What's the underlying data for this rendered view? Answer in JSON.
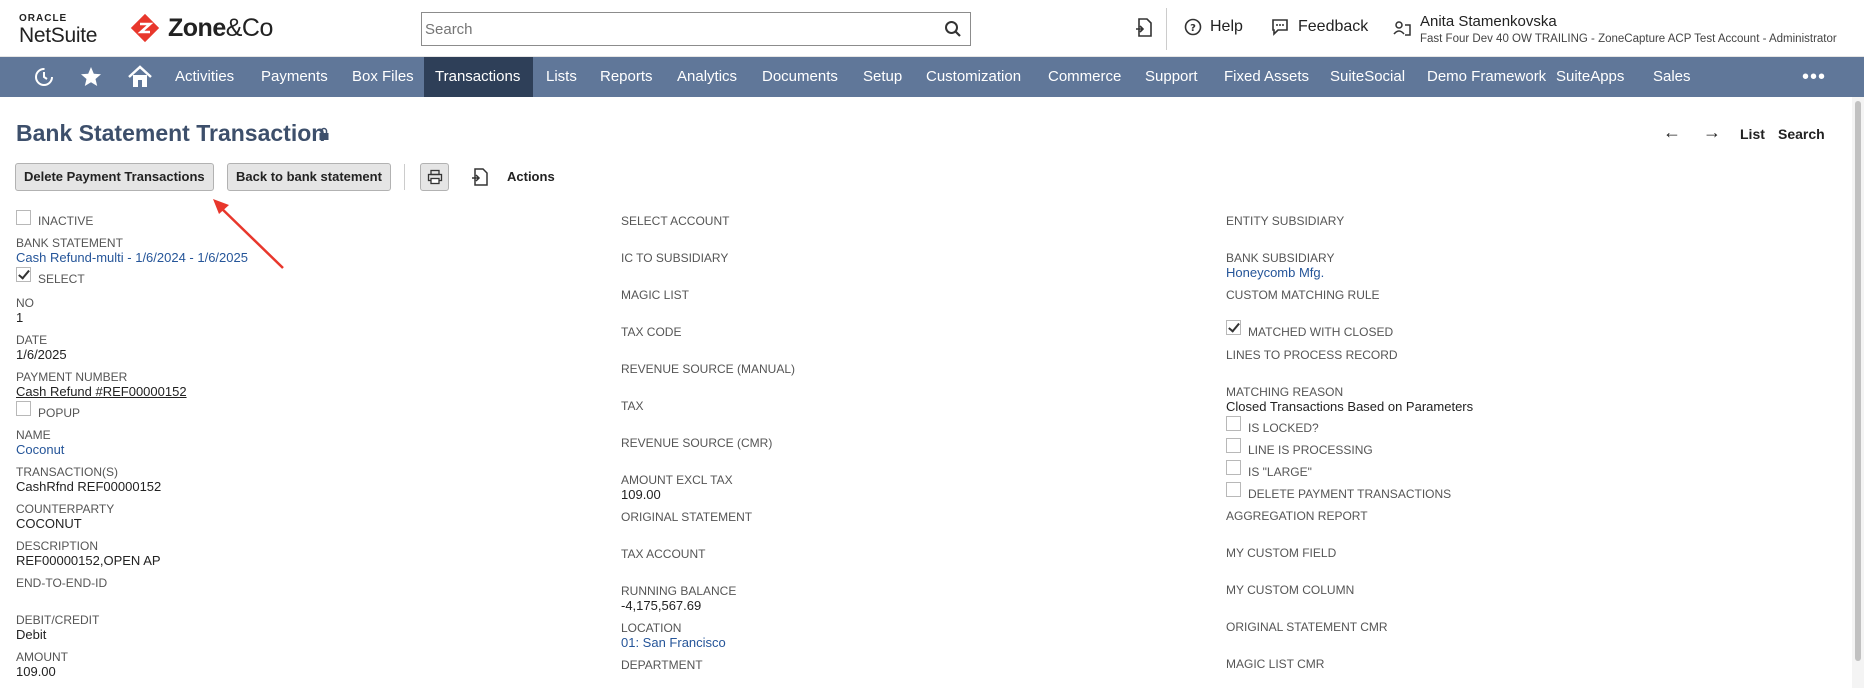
{
  "header": {
    "oracle": "ORACLE",
    "netsuite": "NetSuite",
    "zone": "Zone",
    "zone_co": "&Co",
    "search_placeholder": "Search",
    "help": "Help",
    "feedback": "Feedback",
    "user_name": "Anita Stamenkovska",
    "user_account": "Fast Four Dev 40 OW TRAILING - ZoneCapture ACP Test Account - Administrator"
  },
  "nav": {
    "items": [
      "Activities",
      "Payments",
      "Box Files",
      "Transactions",
      "Lists",
      "Reports",
      "Analytics",
      "Documents",
      "Setup",
      "Customization",
      "Commerce",
      "Support",
      "Fixed Assets",
      "SuiteSocial",
      "Demo Framework",
      "SuiteApps",
      "Sales"
    ],
    "active": "Transactions",
    "more": "•••"
  },
  "page": {
    "title": "Bank Statement Transaction",
    "right_nav": {
      "prev": "←",
      "next": "→",
      "list": "List",
      "search": "Search"
    }
  },
  "toolbar": {
    "delete_label": "Delete Payment Transactions",
    "back_label": "Back to bank statement",
    "actions_label": "Actions"
  },
  "col1": {
    "inactive": "INACTIVE",
    "bank_statement_label": "BANK STATEMENT",
    "bank_statement_value": "Cash Refund-multi - 1/6/2024 - 1/6/2025",
    "select": "SELECT",
    "no_label": "NO",
    "no_value": "1",
    "date_label": "DATE",
    "date_value": "1/6/2025",
    "payment_number_label": "PAYMENT NUMBER",
    "payment_number_value": "Cash Refund #REF00000152",
    "popup": "POPUP",
    "name_label": "NAME",
    "name_value": "Coconut",
    "transactions_label": "TRANSACTION(S)",
    "transactions_value": "CashRfnd REF00000152",
    "counterparty_label": "COUNTERPARTY",
    "counterparty_value": "COCONUT",
    "description_label": "DESCRIPTION",
    "description_value": "REF00000152,OPEN AP",
    "e2e_label": "END-TO-END-ID",
    "debit_credit_label": "DEBIT/CREDIT",
    "debit_credit_value": "Debit",
    "amount_label": "AMOUNT",
    "amount_value": "109.00"
  },
  "col2": {
    "select_account": "SELECT ACCOUNT",
    "ic_to_subsidiary": "IC TO SUBSIDIARY",
    "magic_list": "MAGIC LIST",
    "tax_code": "TAX CODE",
    "revenue_source_manual": "REVENUE SOURCE (MANUAL)",
    "tax": "TAX",
    "revenue_source_cmr": "REVENUE SOURCE (CMR)",
    "amount_excl_tax_label": "AMOUNT EXCL TAX",
    "amount_excl_tax_value": "109.00",
    "original_statement": "ORIGINAL STATEMENT",
    "tax_account": "TAX ACCOUNT",
    "running_balance_label": "RUNNING BALANCE",
    "running_balance_value": "-4,175,567.69",
    "location_label": "LOCATION",
    "location_value": "01: San Francisco",
    "department": "DEPARTMENT"
  },
  "col3": {
    "entity_subsidiary": "ENTITY SUBSIDIARY",
    "bank_subsidiary_label": "BANK SUBSIDIARY",
    "bank_subsidiary_value": "Honeycomb Mfg.",
    "custom_matching_rule": "CUSTOM MATCHING RULE",
    "matched_with_closed": "MATCHED WITH CLOSED",
    "lines_to_process": "LINES TO PROCESS RECORD",
    "matching_reason_label": "MATCHING REASON",
    "matching_reason_value": "Closed Transactions Based on Parameters",
    "is_locked": "IS LOCKED?",
    "line_is_processing": "LINE IS PROCESSING",
    "is_large": "IS \"LARGE\"",
    "delete_payment_transactions": "DELETE PAYMENT TRANSACTIONS",
    "aggregation_report": "AGGREGATION REPORT",
    "my_custom_field": "MY CUSTOM FIELD",
    "my_custom_column": "MY CUSTOM COLUMN",
    "original_statement_cmr": "ORIGINAL STATEMENT CMR",
    "magic_list_cmr": "MAGIC LIST CMR"
  },
  "colors": {
    "nav_bg": "#607799",
    "nav_active": "#2e3f58",
    "title": "#3d4f6b",
    "link": "#255599",
    "annotation": "#e8372c",
    "zone_red": "#e8372c"
  }
}
